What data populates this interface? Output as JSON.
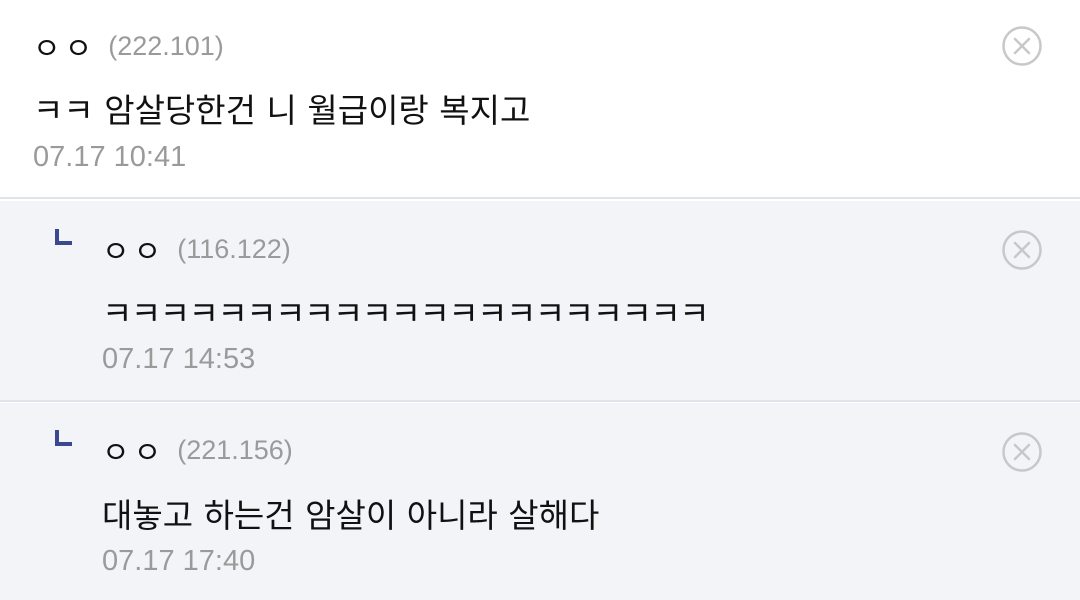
{
  "comments": [
    {
      "nickname": "ㅇㅇ",
      "ip": "(222.101)",
      "text": "ㅋㅋ 암살당한건 니 월급이랑 복지고",
      "date": "07.17 10:41"
    },
    {
      "nickname": "ㅇㅇ",
      "ip": "(116.122)",
      "text": "ㅋㅋㅋㅋㅋㅋㅋㅋㅋㅋㅋㅋㅋㅋㅋㅋㅋㅋㅋㅋㅋ",
      "date": "07.17 14:53"
    },
    {
      "nickname": "ㅇㅇ",
      "ip": "(221.156)",
      "text": "대놓고 하는건 암살이 아니라 살해다",
      "date": "07.17 17:40"
    }
  ],
  "icons": {
    "delete": "close-circle-icon",
    "reply": "reply-arrow-icon"
  },
  "colors": {
    "reply_background": "#f3f4f8",
    "divider": "#dfe3ec",
    "reply_icon": "#3b4890",
    "meta_gray": "#9a9a9a",
    "delete_icon": "#c8c8c8"
  }
}
